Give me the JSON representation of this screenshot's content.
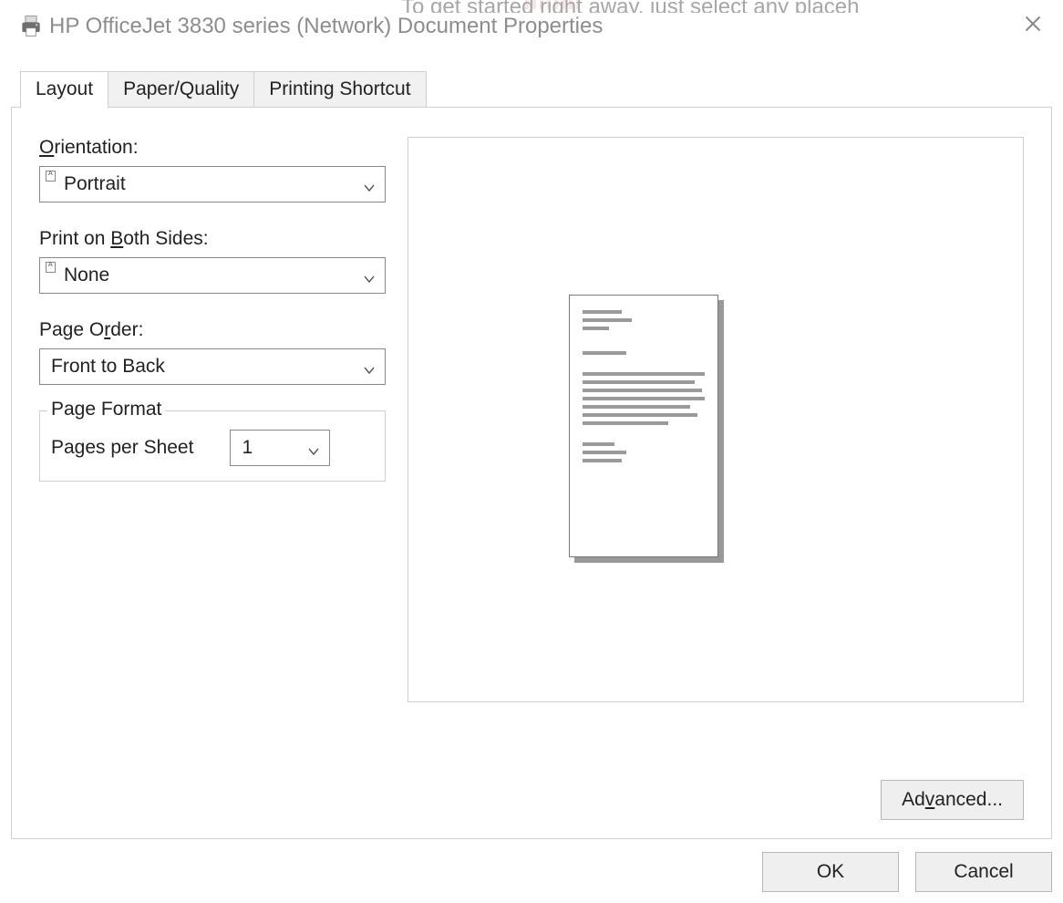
{
  "background_text": "To get started right away, just select any placeh",
  "window": {
    "title": "HP OfficeJet 3830 series (Network) Document Properties"
  },
  "tabs": {
    "layout": "Layout",
    "paper_quality": "Paper/Quality",
    "printing_shortcut": "Printing Shortcut"
  },
  "layout": {
    "orientation_label_pre": "O",
    "orientation_label_post": "rientation:",
    "orientation_value": "Portrait",
    "both_sides_label_pre": "Print on ",
    "both_sides_label_ul": "B",
    "both_sides_label_post": "oth Sides:",
    "both_sides_value": "None",
    "page_order_label_pre": "Page O",
    "page_order_label_ul": "r",
    "page_order_label_post": "der:",
    "page_order_value": "Front to Back",
    "page_format_legend": "Page Format",
    "pps_label_pre": "Page",
    "pps_label_ul": "s",
    "pps_label_post": " per Sheet",
    "pps_value": "1"
  },
  "buttons": {
    "advanced_pre": "Ad",
    "advanced_ul": "v",
    "advanced_post": "anced...",
    "ok": "OK",
    "cancel": "Cancel"
  }
}
